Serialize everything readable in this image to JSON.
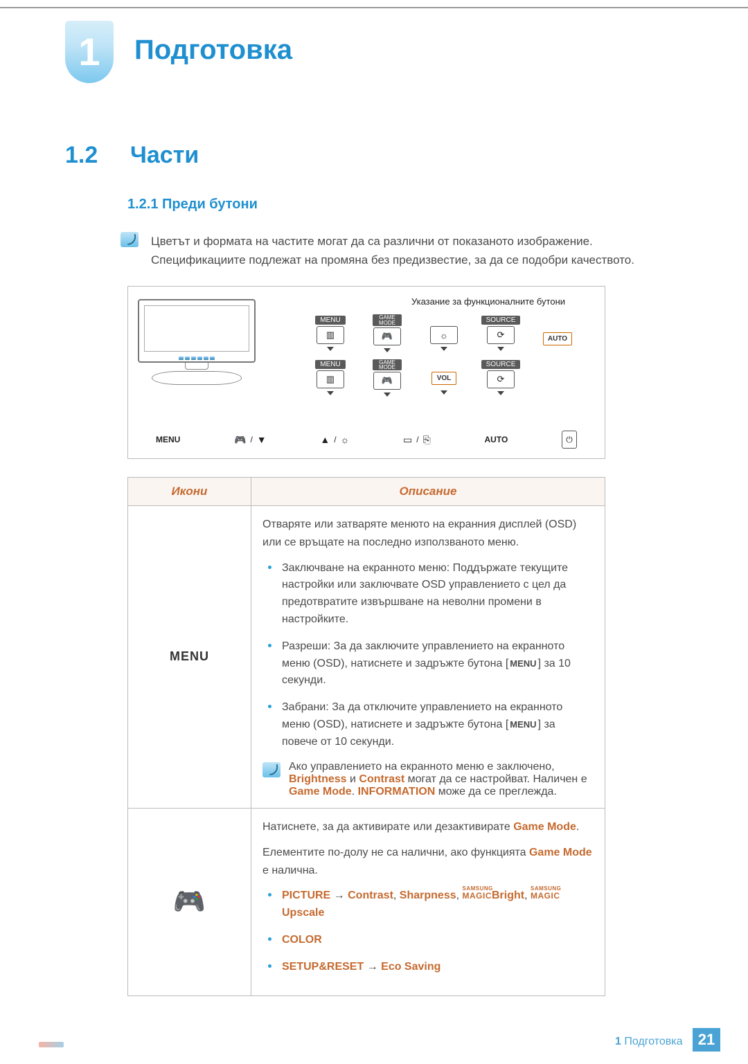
{
  "chapter": {
    "number": "1",
    "title": "Подготовка"
  },
  "section": {
    "number": "1.2",
    "title": "Части"
  },
  "subsection": {
    "number_title": "1.2.1  Преди бутони"
  },
  "note": {
    "line1": "Цветът и формата на частите могат да са различни от показаното изображение.",
    "line2": "Спецификациите подлежат на промяна без предизвестие, за да се подобри качеството."
  },
  "diagram": {
    "caption": "Указание за функционалните бутони",
    "labels": {
      "menu": "MENU",
      "game": "GAME",
      "mode": "MODE",
      "source": "SOURCE",
      "auto": "AUTO",
      "vol": "VOL"
    },
    "legend": {
      "menu": "MENU",
      "auto": "AUTO"
    }
  },
  "table": {
    "headers": {
      "icons": "Икони",
      "desc": "Описание"
    },
    "row_menu": {
      "icon_label": "MENU",
      "p1": "Отваряте или затваряте менюто на екранния дисплей (OSD) или се връщате на последно използваното меню.",
      "b1": "Заключване на екранното меню: Поддържате текущите настройки или заключвате OSD управлението с цел да предотвратите извършване на неволни промени в настройките.",
      "b2_a": "Разреши: За да заключите управлението на екранното меню (OSD), натиснете и задръжте бутона [",
      "b2_kbd": "MENU",
      "b2_b": "] за 10 секунди.",
      "b3_a": "Забрани: За да отключите управлението на екранното меню (OSD), натиснете и задръжте бутона [",
      "b3_kbd": "MENU",
      "b3_b": "] за повече от 10 секунди.",
      "note1": "Ако управлението на екранното меню е заключено,",
      "note2_a": "Brightness",
      "note2_b": " и ",
      "note2_c": "Contrast",
      "note2_d": " могат да се настройват. Наличен е ",
      "note2_e": "Game Mode",
      "note2_f": ". ",
      "note2_g": "INFORMATION",
      "note2_h": " може да се преглежда."
    },
    "row_game": {
      "p1_a": "Натиснете, за да активирате или дезактивирате ",
      "p1_b": "Game Mode",
      "p1_c": ".",
      "p2_a": "Елементите по-долу не са налични, ако функцията ",
      "p2_b": "Game Mode",
      "p2_c": " е налична.",
      "b1_a": "PICTURE",
      "b1_arrow": "  →  ",
      "b1_b": "Contrast",
      "b1_c": ", ",
      "b1_d": "Sharpness",
      "b1_e": ", ",
      "b1_magic1_sup": "SAMSUNG",
      "b1_magic1_main": "MAGIC",
      "b1_f": "Bright",
      "b1_g": ", ",
      "b1_magic2_sup": "SAMSUNG",
      "b1_magic2_main": "MAGIC",
      "b1_h": "Upscale",
      "b2": "COLOR",
      "b3_a": "SETUP&RESET",
      "b3_arrow": "  →  ",
      "b3_b": "Eco Saving"
    }
  },
  "footer": {
    "breadcrumb_num": "1",
    "breadcrumb_text": "Подготовка",
    "page": "21"
  }
}
